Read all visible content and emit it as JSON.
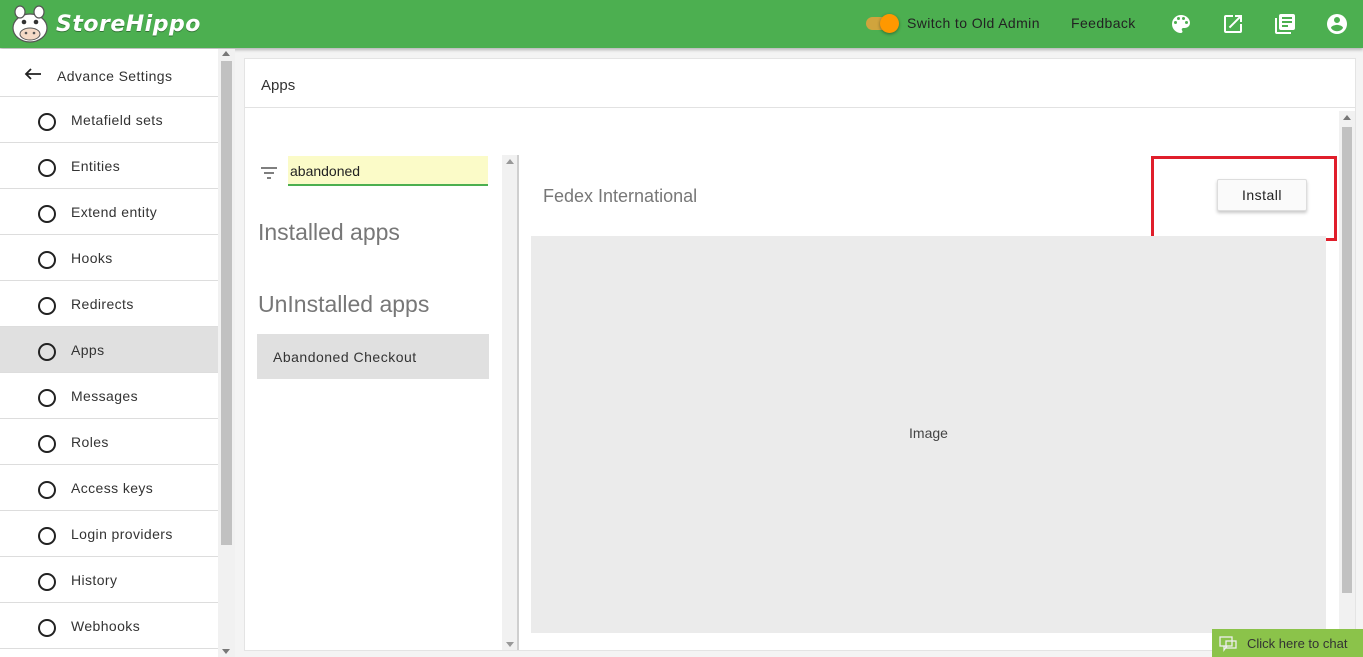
{
  "colors": {
    "topbar": "#4caf50",
    "accent": "#ff9800",
    "highlight": "#e01e2b",
    "chat": "#8bc34a"
  },
  "brand": {
    "name": "StoreHippo"
  },
  "header": {
    "switch_label": "Switch to Old Admin",
    "feedback_label": "Feedback",
    "icons": [
      "palette-icon",
      "open-external-icon",
      "docs-icon",
      "account-icon"
    ]
  },
  "sidebar": {
    "back_label": "Advance Settings",
    "items": [
      {
        "label": "Metafield sets"
      },
      {
        "label": "Entities"
      },
      {
        "label": "Extend entity"
      },
      {
        "label": "Hooks"
      },
      {
        "label": "Redirects"
      },
      {
        "label": "Apps",
        "active": true
      },
      {
        "label": "Messages"
      },
      {
        "label": "Roles"
      },
      {
        "label": "Access keys"
      },
      {
        "label": "Login providers"
      },
      {
        "label": "History"
      },
      {
        "label": "Webhooks"
      }
    ]
  },
  "main": {
    "title": "Apps",
    "search": {
      "value": "abandoned"
    },
    "installed_title": "Installed apps",
    "uninstalled_title": "UnInstalled apps",
    "uninstalled_apps": [
      {
        "label": "Abandoned Checkout"
      }
    ],
    "detail": {
      "title": "Fedex International",
      "install_label": "Install",
      "image_label": "Image"
    }
  },
  "chat": {
    "label": "Click here to chat"
  }
}
